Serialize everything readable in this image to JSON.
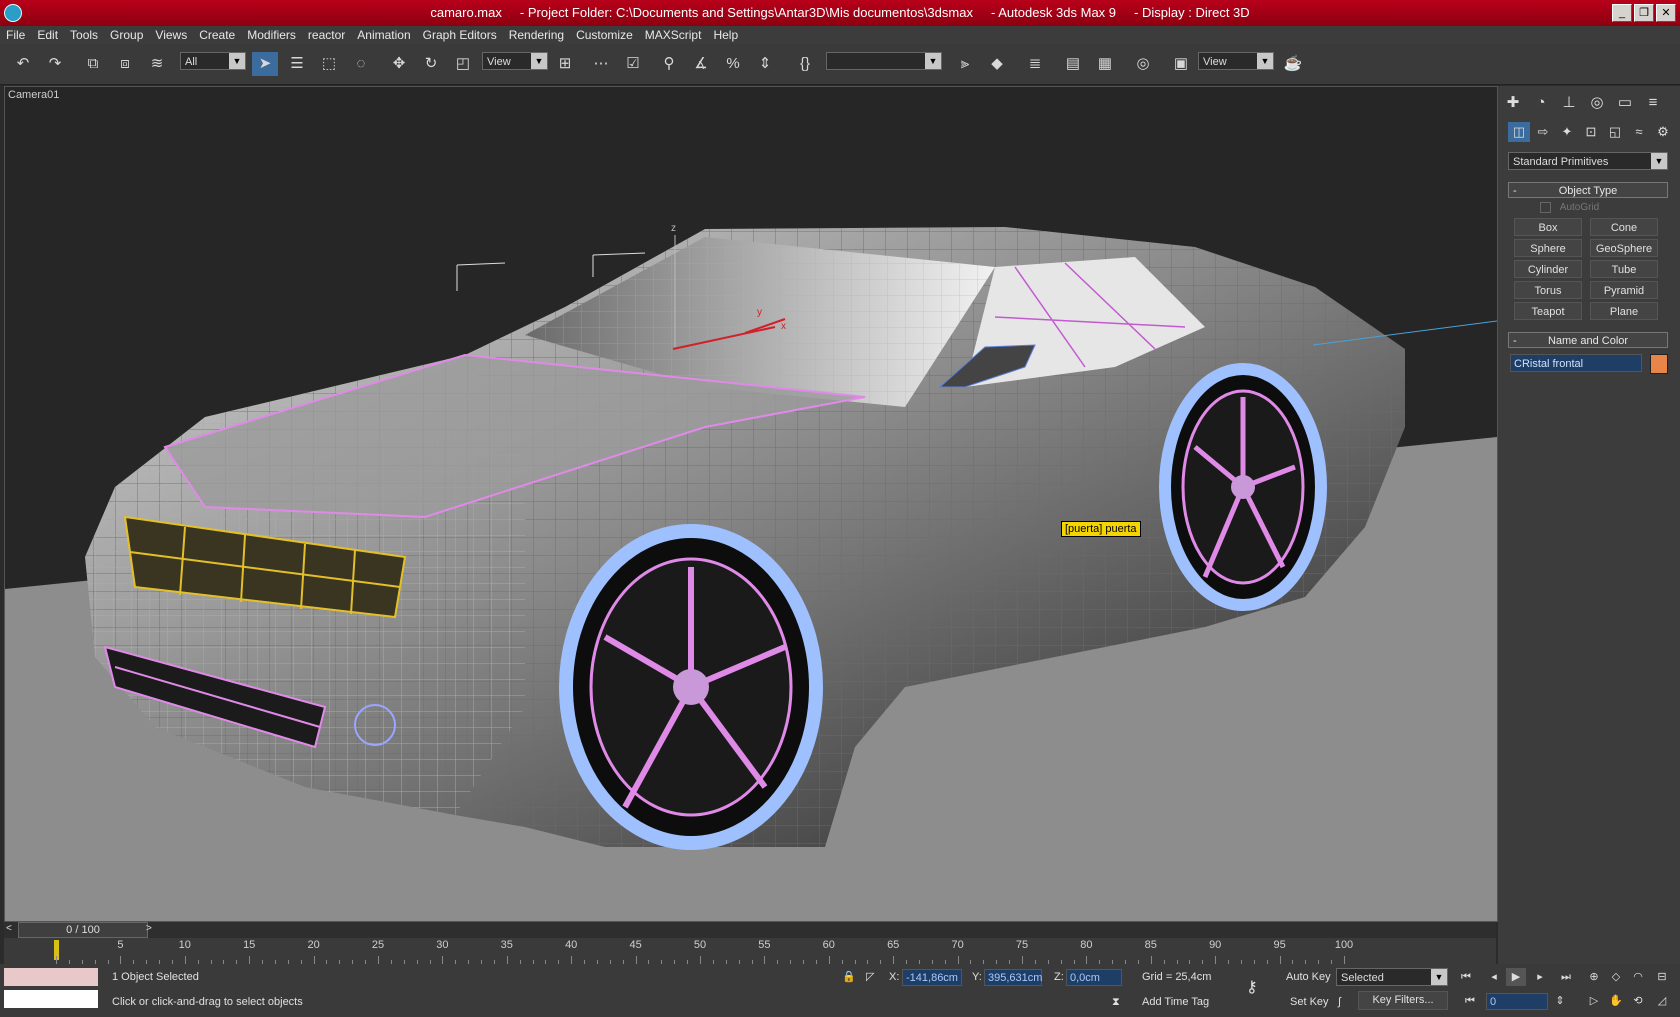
{
  "window": {
    "title": "camaro.max     - Project Folder: C:\\Documents and Settings\\Antar3D\\Mis documentos\\3dsmax     - Autodesk 3ds Max 9     - Display : Direct 3D",
    "buttons": [
      "_",
      "❐",
      "✕"
    ]
  },
  "menu": [
    "File",
    "Edit",
    "Tools",
    "Group",
    "Views",
    "Create",
    "Modifiers",
    "reactor",
    "Animation",
    "Graph Editors",
    "Rendering",
    "Customize",
    "MAXScript",
    "Help"
  ],
  "toolbar": {
    "selection_filter": "All",
    "ref_coord": "View",
    "named_selection": "",
    "render_type": "View"
  },
  "viewport": {
    "label": "Camera01",
    "tooltip": "[puerta] puerta",
    "axis_labels": {
      "x": "x",
      "y": "y",
      "z": "z"
    }
  },
  "command_panel": {
    "dropdown": "Standard Primitives",
    "object_type": {
      "header": "Object Type",
      "autogrid": "AutoGrid",
      "buttons": [
        "Box",
        "Cone",
        "Sphere",
        "GeoSphere",
        "Cylinder",
        "Tube",
        "Torus",
        "Pyramid",
        "Teapot",
        "Plane"
      ]
    },
    "name_and_color": {
      "header": "Name and Color",
      "name": "CRistal frontal",
      "color": "#e8864a"
    }
  },
  "time_slider": {
    "label": "0 / 100"
  },
  "trackbar": {
    "ticks": [
      "5",
      "10",
      "15",
      "20",
      "25",
      "30",
      "35",
      "40",
      "45",
      "50",
      "55",
      "60",
      "65",
      "70",
      "75",
      "80",
      "85",
      "90",
      "95",
      "100"
    ]
  },
  "status": {
    "selection": "1 Object Selected",
    "prompt": "Click or click-and-drag to select objects",
    "x_label": "X:",
    "x": "-141,86cm",
    "y_label": "Y:",
    "y": "395,631cm",
    "z_label": "Z:",
    "z": "0,0cm",
    "grid": "Grid = 25,4cm",
    "add_time_tag": "Add Time Tag",
    "auto_key": "Auto Key",
    "set_key": "Set Key",
    "key_mode": "Selected",
    "key_filters": "Key Filters...",
    "frame": "0"
  }
}
